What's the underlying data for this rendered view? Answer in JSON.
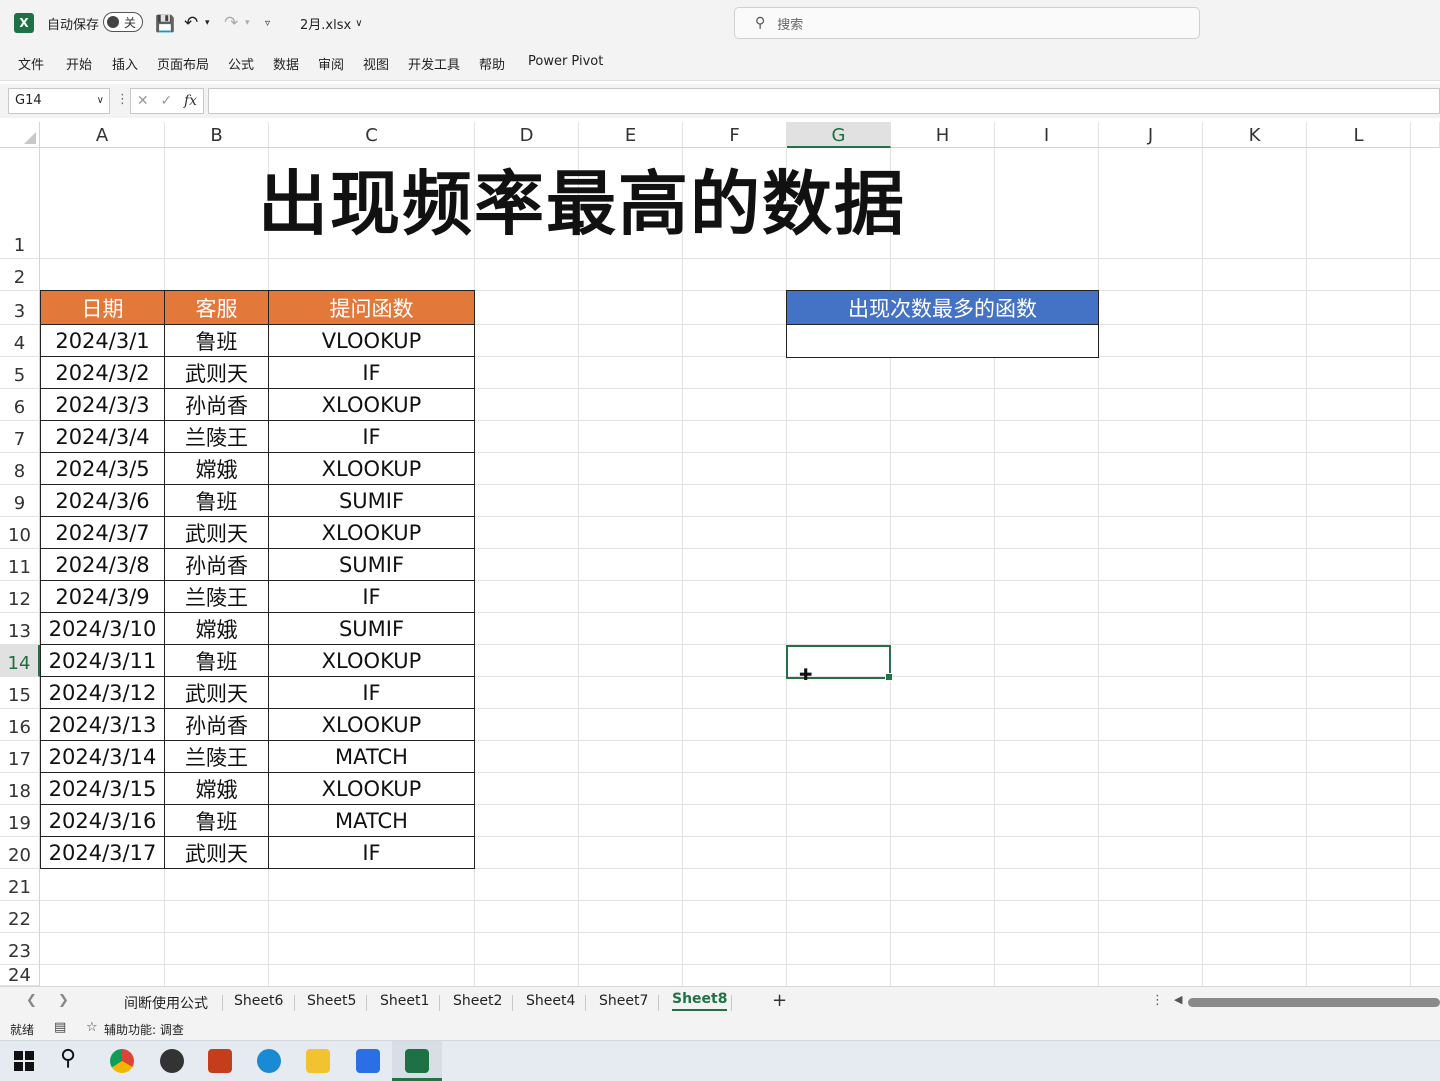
{
  "titlebar": {
    "logo": "X",
    "autosave_label": "自动保存",
    "autosave_state": "关",
    "filename": "2月.xlsx",
    "search_placeholder": "搜索"
  },
  "menu": [
    "文件",
    "开始",
    "插入",
    "页面布局",
    "公式",
    "数据",
    "审阅",
    "视图",
    "开发工具",
    "帮助",
    "Power Pivot"
  ],
  "formula_bar": {
    "name_box": "G14",
    "fx": "fx",
    "formula": ""
  },
  "columns": [
    "A",
    "B",
    "C",
    "D",
    "E",
    "F",
    "G",
    "H",
    "I",
    "J",
    "K",
    "L"
  ],
  "rows": [
    "1",
    "2",
    "3",
    "4",
    "5",
    "6",
    "7",
    "8",
    "9",
    "10",
    "11",
    "12",
    "13",
    "14",
    "15",
    "16",
    "17",
    "18",
    "19",
    "20",
    "21",
    "22",
    "23",
    "24"
  ],
  "selected": {
    "col": "G",
    "row": "14"
  },
  "sheet_title": "出现频率最高的数据",
  "table": {
    "headers": [
      "日期",
      "客服",
      "提问函数"
    ],
    "rows": [
      [
        "2024/3/1",
        "鲁班",
        "VLOOKUP"
      ],
      [
        "2024/3/2",
        "武则天",
        "IF"
      ],
      [
        "2024/3/3",
        "孙尚香",
        "XLOOKUP"
      ],
      [
        "2024/3/4",
        "兰陵王",
        "IF"
      ],
      [
        "2024/3/5",
        "嫦娥",
        "XLOOKUP"
      ],
      [
        "2024/3/6",
        "鲁班",
        "SUMIF"
      ],
      [
        "2024/3/7",
        "武则天",
        "XLOOKUP"
      ],
      [
        "2024/3/8",
        "孙尚香",
        "SUMIF"
      ],
      [
        "2024/3/9",
        "兰陵王",
        "IF"
      ],
      [
        "2024/3/10",
        "嫦娥",
        "SUMIF"
      ],
      [
        "2024/3/11",
        "鲁班",
        "XLOOKUP"
      ],
      [
        "2024/3/12",
        "武则天",
        "IF"
      ],
      [
        "2024/3/13",
        "孙尚香",
        "XLOOKUP"
      ],
      [
        "2024/3/14",
        "兰陵王",
        "MATCH"
      ],
      [
        "2024/3/15",
        "嫦娥",
        "XLOOKUP"
      ],
      [
        "2024/3/16",
        "鲁班",
        "MATCH"
      ],
      [
        "2024/3/17",
        "武则天",
        "IF"
      ]
    ]
  },
  "result_box": {
    "header": "出现次数最多的函数",
    "value": ""
  },
  "sheets": [
    "间断使用公式",
    "Sheet6",
    "Sheet5",
    "Sheet1",
    "Sheet2",
    "Sheet4",
    "Sheet7",
    "Sheet8"
  ],
  "active_sheet": "Sheet8",
  "statusbar": {
    "ready": "就绪",
    "accessibility": "辅助功能: 调查"
  },
  "colors": {
    "accent": "#217346",
    "table_header": "#e2793a",
    "result_header": "#4472c4"
  }
}
